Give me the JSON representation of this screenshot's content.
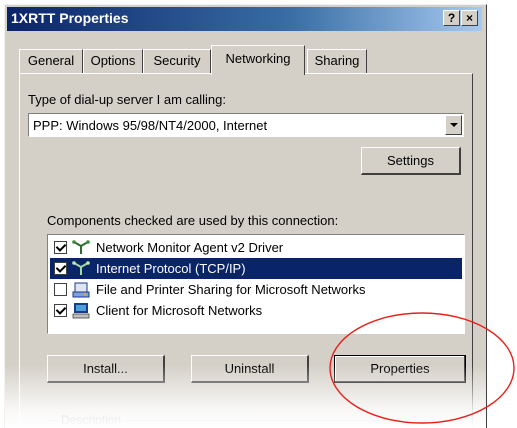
{
  "window": {
    "title": "1XRTT Properties",
    "help_btn": "?",
    "close_btn": "×"
  },
  "tabs": [
    {
      "label": "General",
      "active": false
    },
    {
      "label": "Options",
      "active": false
    },
    {
      "label": "Security",
      "active": false
    },
    {
      "label": "Networking",
      "active": true
    },
    {
      "label": "Sharing",
      "active": false
    }
  ],
  "networking": {
    "server_type_label": "Type of dial-up server I am calling:",
    "server_type_value": "PPP: Windows 95/98/NT4/2000, Internet",
    "settings_button": "Settings",
    "components_label": "Components checked are used by this connection:",
    "components": [
      {
        "label": "Network Monitor Agent v2 Driver",
        "checked": true,
        "selected": false,
        "icon": "network-protocol-icon"
      },
      {
        "label": "Internet Protocol (TCP/IP)",
        "checked": true,
        "selected": true,
        "icon": "network-protocol-icon"
      },
      {
        "label": "File and Printer Sharing for Microsoft Networks",
        "checked": false,
        "selected": false,
        "icon": "network-service-icon"
      },
      {
        "label": "Client for Microsoft Networks",
        "checked": true,
        "selected": false,
        "icon": "network-client-icon"
      }
    ],
    "install_button": "Install...",
    "uninstall_button": "Uninstall",
    "properties_button": "Properties",
    "description_caption": "Description"
  },
  "annotation": {
    "color": "#e8201a"
  }
}
